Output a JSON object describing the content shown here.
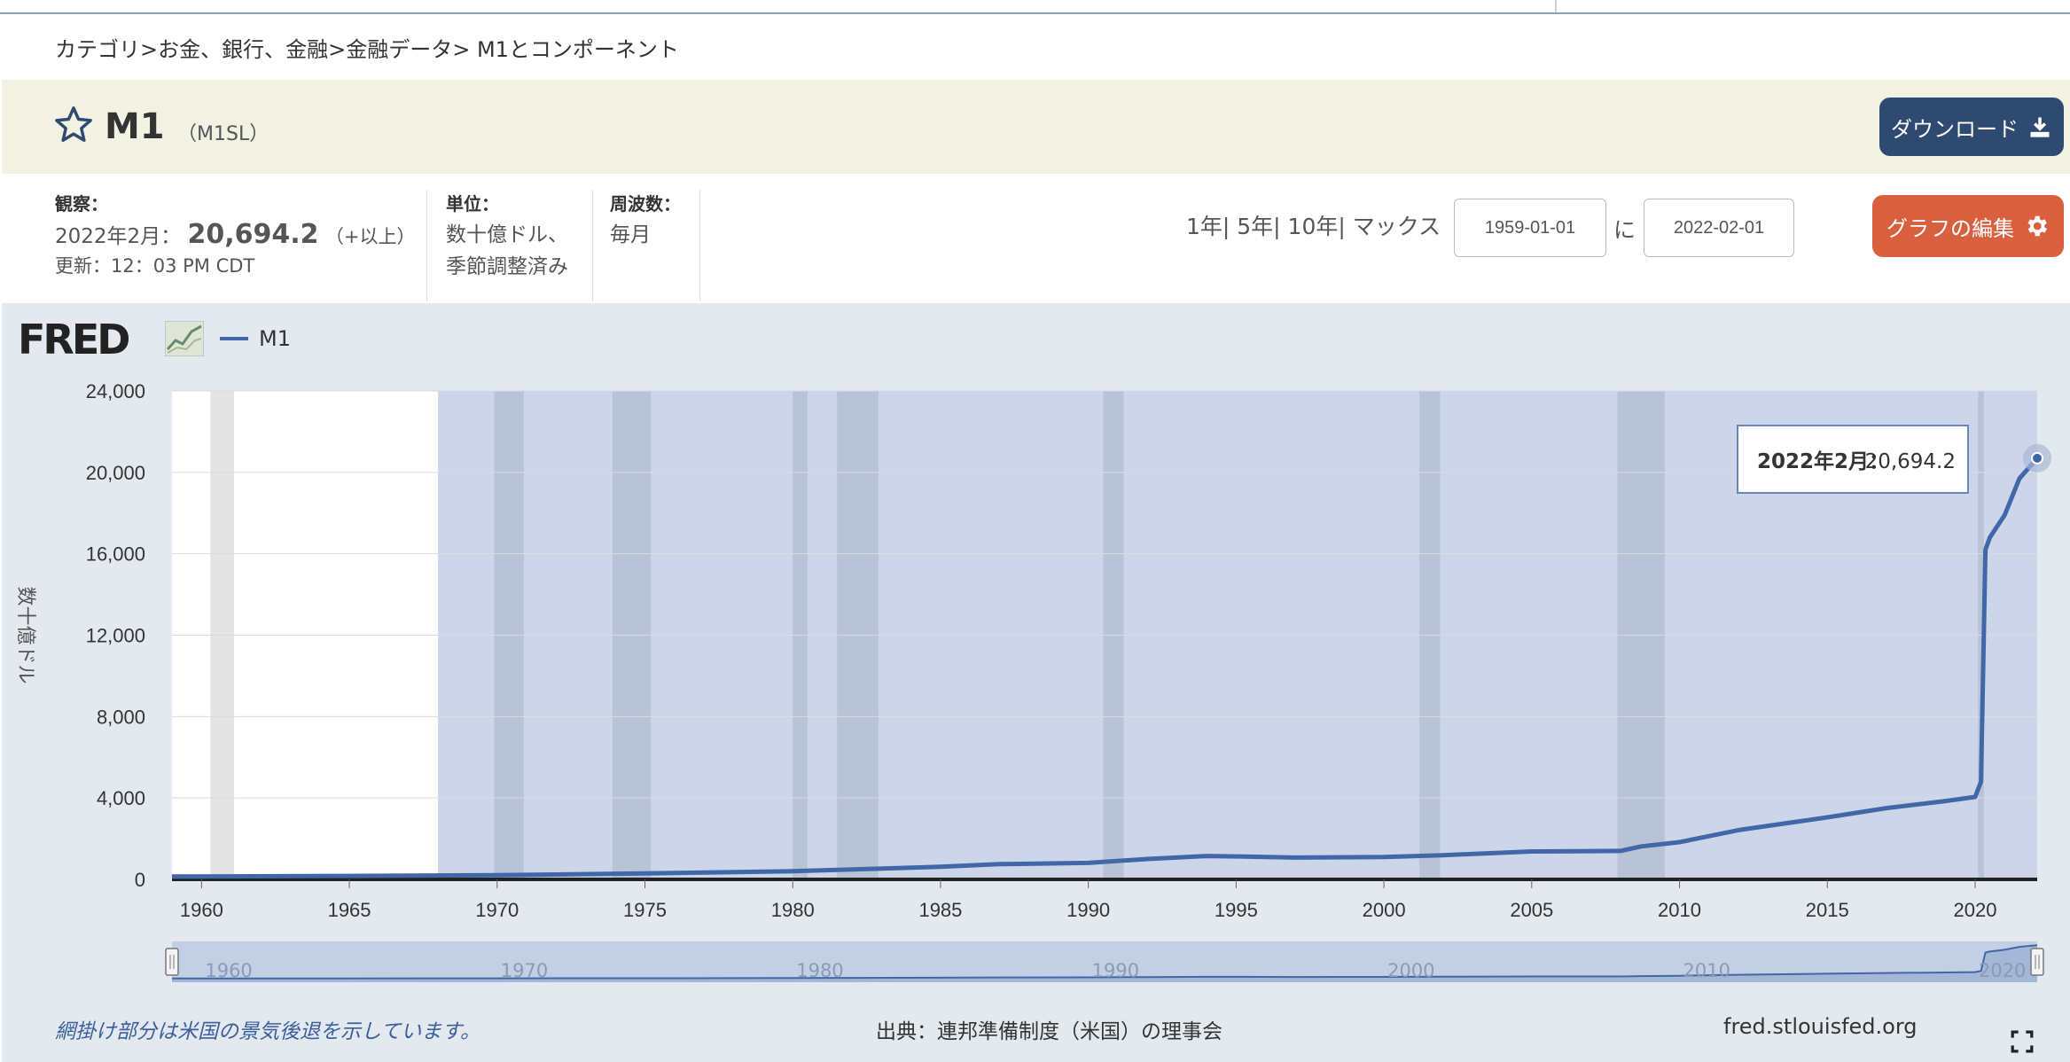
{
  "breadcrumb": {
    "items": [
      "カテゴリ",
      "お金、銀行、金融",
      "金融データ",
      " M1とコンポーネント"
    ],
    "separator": ">"
  },
  "header": {
    "title": "M1",
    "code": "（M1SL）",
    "download_label": "ダウンロード"
  },
  "meta": {
    "obs_label": "観察：",
    "obs_date": "2022年2月：",
    "obs_value": "20,694.2",
    "obs_more": "（+以上）",
    "updated": "更新：12：03 PM CDT",
    "units_label": "単位：",
    "units_line1": "数十億ドル、",
    "units_line2": "季節調整済み",
    "freq_label": "周波数：",
    "freq_value": "毎月"
  },
  "controls": {
    "range_links": "1年| 5年| 10年| マックス",
    "start_date": "1959-01-01",
    "to_label": "に",
    "end_date": "2022-02-01",
    "edit_label": "グラフの編集"
  },
  "legend": {
    "logo": "FRED",
    "series_label": "M1"
  },
  "colors": {
    "series": "#4267a8",
    "recession": "#b9c3d6",
    "shade": "#ccd6e8",
    "download_btn": "#2e4a70",
    "edit_btn": "#d9603f"
  },
  "chart_data": {
    "type": "line",
    "ylabel": "数十億ドル",
    "ylim": [
      0,
      24000
    ],
    "xlim": [
      1959.0,
      2022.1
    ],
    "y_ticks": [
      "0",
      "4,000",
      "8,000",
      "12,000",
      "16,000",
      "20,000",
      "24,000"
    ],
    "y_tick_values": [
      0,
      4000,
      8000,
      12000,
      16000,
      20000,
      24000
    ],
    "x_ticks": [
      "1960",
      "1965",
      "1970",
      "1975",
      "1980",
      "1985",
      "1990",
      "1995",
      "2000",
      "2005",
      "2010",
      "2015",
      "2020"
    ],
    "x_tick_values": [
      1960,
      1965,
      1970,
      1975,
      1980,
      1985,
      1990,
      1995,
      2000,
      2005,
      2010,
      2015,
      2020
    ],
    "grid": true,
    "series": [
      {
        "name": "M1",
        "x": [
          1959.0,
          1965.0,
          1970.0,
          1975.0,
          1980.0,
          1985.0,
          1987.0,
          1990.0,
          1992.0,
          1994.0,
          1995.0,
          1997.0,
          2000.0,
          2002.0,
          2005.0,
          2008.0,
          2008.7,
          2010.0,
          2012.0,
          2015.0,
          2017.0,
          2019.0,
          2020.0,
          2020.2,
          2020.35,
          2020.5,
          2021.0,
          2021.5,
          2022.1
        ],
        "y": [
          140,
          170,
          210,
          290,
          400,
          620,
          750,
          810,
          1000,
          1150,
          1130,
          1070,
          1100,
          1190,
          1370,
          1400,
          1620,
          1830,
          2420,
          3050,
          3500,
          3850,
          4050,
          4800,
          16200,
          16800,
          17900,
          19700,
          20694.2
        ]
      }
    ],
    "recessions": [
      [
        1960.3,
        1961.1
      ],
      [
        1969.9,
        1970.9
      ],
      [
        1973.9,
        1975.2
      ],
      [
        1980.0,
        1980.5
      ],
      [
        1981.5,
        1982.9
      ],
      [
        1990.5,
        1991.2
      ],
      [
        2001.2,
        2001.9
      ],
      [
        2007.9,
        2009.5
      ],
      [
        2020.1,
        2020.3
      ]
    ],
    "shaded_range": [
      1968.0,
      2022.1
    ],
    "tooltip": {
      "date": "2022年2月：",
      "value": "20,694.2",
      "x": 2022.1,
      "y": 20694.2
    },
    "navigator_ticks": [
      "1960",
      "1970",
      "1980",
      "1990",
      "2000",
      "2010",
      "2020"
    ],
    "navigator_tick_values": [
      1960,
      1970,
      1980,
      1990,
      2000,
      2010,
      2020
    ]
  },
  "footer": {
    "footnote": "網掛け部分は米国の景気後退を示しています。",
    "source": "出典：連邦準備制度（米国）の理事会",
    "site": "fred.stlouisfed.org"
  }
}
